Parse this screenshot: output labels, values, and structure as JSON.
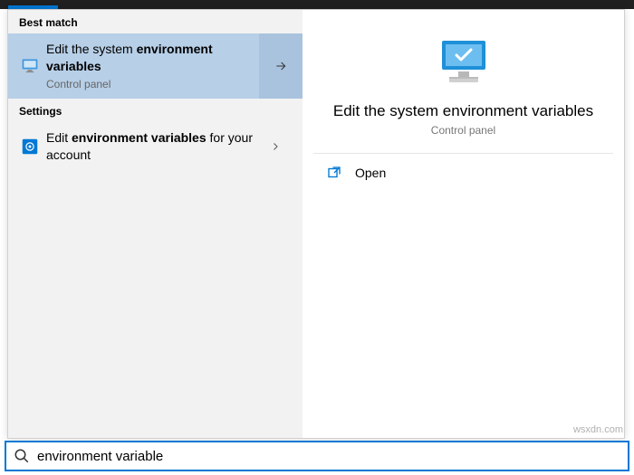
{
  "left": {
    "best_match_header": "Best match",
    "settings_header": "Settings",
    "selected": {
      "line1_a": "Edit the system ",
      "line1_b": "environment variables",
      "category": "Control panel"
    },
    "second": {
      "line_a": "Edit ",
      "line_b": "environment variables",
      "line_c": " for your account"
    }
  },
  "detail": {
    "title": "Edit the system environment variables",
    "category": "Control panel",
    "open_label": "Open"
  },
  "search": {
    "query": "environment variable"
  },
  "watermark": "wsxdn.com"
}
